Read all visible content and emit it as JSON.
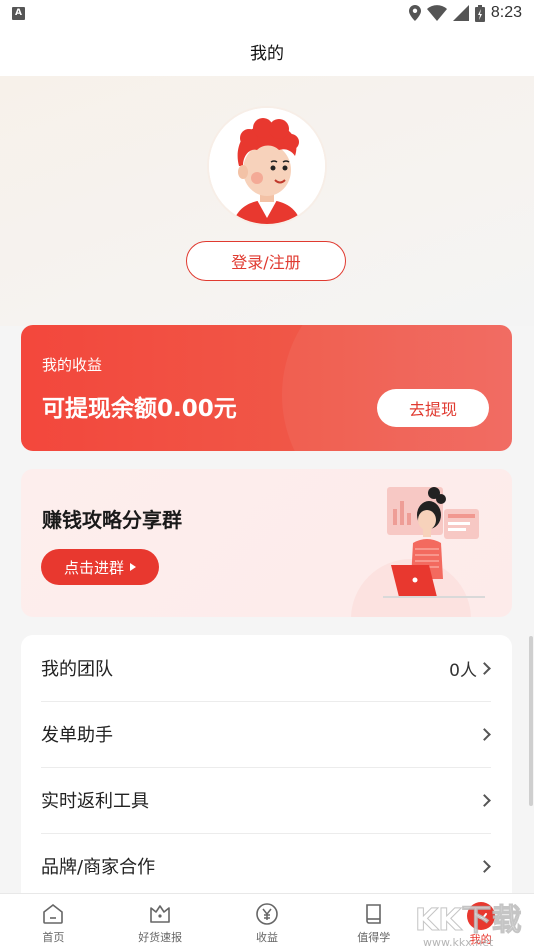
{
  "status_bar": {
    "time": "8:23",
    "indicator": "A"
  },
  "header": {
    "title": "我的"
  },
  "profile": {
    "login_label": "登录/注册"
  },
  "earnings": {
    "label": "我的收益",
    "amount_text": "可提现余额0.00元",
    "withdraw_label": "去提现"
  },
  "group": {
    "title": "赚钱攻略分享群",
    "join_label": "点击进群"
  },
  "menu": {
    "items": [
      {
        "label": "我的团队",
        "value": "0人"
      },
      {
        "label": "发单助手",
        "value": ""
      },
      {
        "label": "实时返利工具",
        "value": ""
      },
      {
        "label": "品牌/商家合作",
        "value": ""
      }
    ]
  },
  "tabs": [
    {
      "label": "首页",
      "icon": "home-icon"
    },
    {
      "label": "好货速报",
      "icon": "crown-icon"
    },
    {
      "label": "收益",
      "icon": "yuan-icon"
    },
    {
      "label": "值得学",
      "icon": "book-icon"
    },
    {
      "label": "我的",
      "icon": "smile-icon"
    }
  ],
  "watermark": {
    "text": "KK下载",
    "url_text": "www.kkx.net"
  },
  "colors": {
    "accent": "#e8382f",
    "card_gradient_start": "#f3473c",
    "group_bg": "#fdeeed"
  }
}
